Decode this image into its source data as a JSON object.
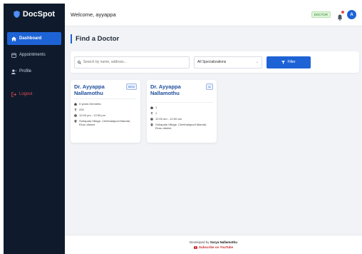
{
  "brand": {
    "name": "DocSpot"
  },
  "sidebar": {
    "items": [
      {
        "label": "Dashboard",
        "icon": "home-icon",
        "active": true
      },
      {
        "label": "Appointments",
        "icon": "calendar-icon",
        "active": false
      },
      {
        "label": "Profile",
        "icon": "user-icon",
        "active": false
      }
    ],
    "logout_label": "Logout"
  },
  "topbar": {
    "welcome": "Welcome, ayyappa",
    "role_badge": "DOCTOR",
    "avatar_initial": "A"
  },
  "page": {
    "title": "Find a Doctor"
  },
  "filters": {
    "search_placeholder": "Search by name, address...",
    "specialization_selected": "All Specializations",
    "filter_label": "Filter"
  },
  "doctors": [
    {
      "name": "Dr. Ayyappa Nallamothu",
      "tag": "NEW",
      "experience": "5 years Dermetto",
      "fee": "200",
      "timing": "12:00 pm - 12:59 pm",
      "address": "Gullapala Village, Chinthalapudi Mandal, Eluru district."
    },
    {
      "name": "Dr. Ayyappa Nallamothu",
      "tag": "11",
      "experience": "1",
      "fee": "1",
      "timing": "12:00 am - 12:00 am",
      "address": "Gullapala Village, Chinthalapudi Mandal, Eluru district."
    }
  ],
  "footer": {
    "developed_by_prefix": "Developed by",
    "developer": "Surya Nallamothu",
    "youtube_label": "Subscribe on YouTube"
  },
  "colors": {
    "sidebar_bg": "#0f1b2d",
    "accent": "#1e63d6",
    "logout": "#e5484d",
    "youtube": "#c62828"
  }
}
